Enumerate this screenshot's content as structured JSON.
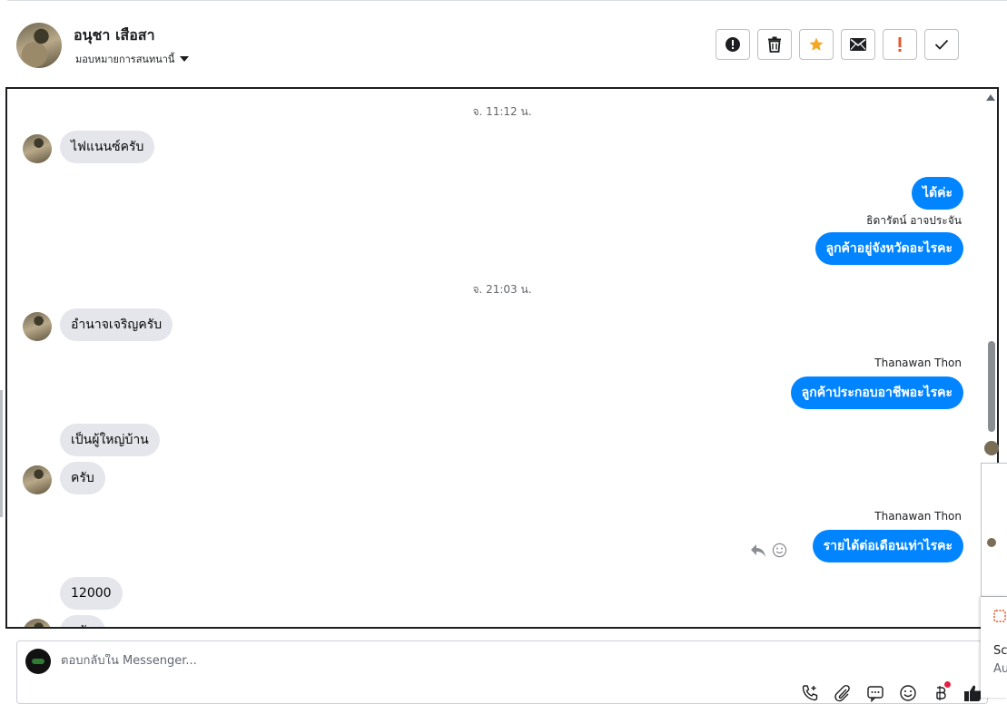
{
  "header": {
    "contact_name": "อนุชา เสือสา",
    "assign_label": "มอบหมายการสนทนานี้",
    "actions": [
      {
        "name": "spam-icon",
        "label": "Mark as spam"
      },
      {
        "name": "trash-icon",
        "label": "Delete"
      },
      {
        "name": "star-icon",
        "label": "Star"
      },
      {
        "name": "mail-icon",
        "label": "Mark unread"
      },
      {
        "name": "exclamation-icon",
        "label": "Follow up"
      },
      {
        "name": "check-icon",
        "label": "Done"
      }
    ],
    "accent_star": "#f5a623",
    "accent_exclaim": "#e4572e"
  },
  "chat": {
    "timestamps": [
      "จ. 11:12 น.",
      "จ. 21:03 น."
    ],
    "messages": [
      {
        "dir": "in",
        "text": "ไฟแนนซ์ครับ"
      },
      {
        "dir": "out",
        "text": "ได้ค่ะ"
      },
      {
        "dir": "out",
        "sender": "ธิดารัตน์ อาจประจัน",
        "text": "ลูกค้าอยู่จังหวัดอะไรคะ"
      },
      {
        "dir": "in",
        "text": "อำนาจเจริญครับ"
      },
      {
        "dir": "out",
        "sender": "Thanawan Thon",
        "text": "ลูกค้าประกอบอาชีพอะไรคะ"
      },
      {
        "dir": "in",
        "text": "เป็นผู้ใหญ่บ้าน"
      },
      {
        "dir": "in",
        "text": "ครับ"
      },
      {
        "dir": "out",
        "sender": "Thanawan Thon",
        "text": "รายได้ต่อเดือนเท่าไรคะ"
      },
      {
        "dir": "in",
        "text": "12000"
      },
      {
        "dir": "in",
        "text": "ครับ"
      }
    ],
    "outgoing_color": "#0084ff",
    "incoming_color": "#e4e6eb"
  },
  "composer": {
    "placeholder": "ตอบกลับใน Messenger...",
    "tools": [
      "phone-plus-icon",
      "attachment-icon",
      "saved-reply-icon",
      "emoji-icon",
      "payment-icon",
      "like-icon"
    ]
  },
  "side": {
    "lines": [
      "Sc",
      "Au"
    ]
  }
}
